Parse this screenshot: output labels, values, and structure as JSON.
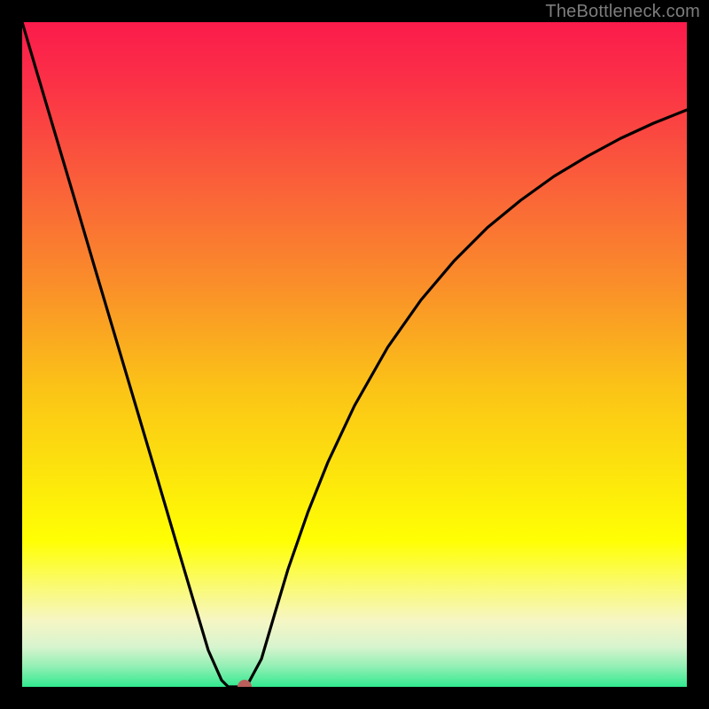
{
  "watermark": "TheBottleneck.com",
  "colors": {
    "frame": "#000000",
    "curve": "#000000",
    "dot": "#bb5f5d",
    "watermark": "#7d7d7d",
    "gradient_stops": [
      {
        "offset": 0.0,
        "color": "#fb1b4c"
      },
      {
        "offset": 0.1,
        "color": "#fb3346"
      },
      {
        "offset": 0.25,
        "color": "#fa6239"
      },
      {
        "offset": 0.4,
        "color": "#fa9029"
      },
      {
        "offset": 0.55,
        "color": "#fbc317"
      },
      {
        "offset": 0.7,
        "color": "#fdea0b"
      },
      {
        "offset": 0.78,
        "color": "#ffff03"
      },
      {
        "offset": 0.85,
        "color": "#fafa75"
      },
      {
        "offset": 0.9,
        "color": "#f6f6c4"
      },
      {
        "offset": 0.94,
        "color": "#d7f4ce"
      },
      {
        "offset": 0.97,
        "color": "#91efb4"
      },
      {
        "offset": 1.0,
        "color": "#32e990"
      }
    ]
  },
  "chart_data": {
    "type": "line",
    "title": "",
    "xlabel": "",
    "ylabel": "",
    "xlim": [
      0,
      100
    ],
    "ylim": [
      0,
      100
    ],
    "grid": false,
    "series": [
      {
        "name": "bottleneck-curve",
        "x": [
          0,
          2,
          5,
          8,
          11,
          14,
          17,
          20,
          23,
          26,
          28,
          30,
          31,
          32,
          33,
          34,
          36,
          38,
          40,
          43,
          46,
          50,
          55,
          60,
          65,
          70,
          75,
          80,
          85,
          90,
          95,
          100
        ],
        "y": [
          100,
          93.2,
          83.1,
          73.0,
          62.8,
          52.7,
          42.6,
          32.5,
          22.3,
          12.2,
          5.5,
          1.0,
          0.0,
          0.0,
          0.0,
          0.5,
          4.2,
          11.0,
          17.7,
          26.3,
          33.8,
          42.3,
          51.1,
          58.2,
          64.1,
          69.1,
          73.2,
          76.8,
          79.8,
          82.5,
          84.8,
          86.8
        ]
      }
    ],
    "marker": {
      "x": 33.5,
      "y": 0,
      "color": "#bb5f5d"
    }
  }
}
